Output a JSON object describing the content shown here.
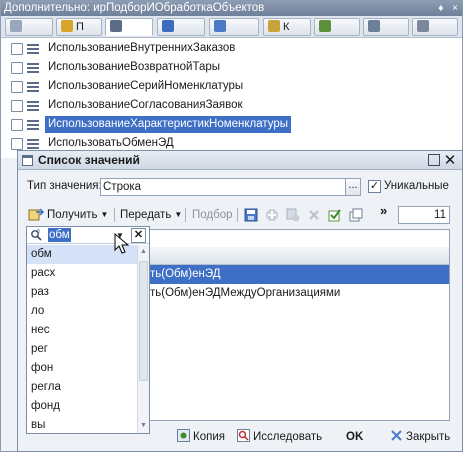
{
  "outer": {
    "title": "Дополнительно: ирПодборИОбработкаОбъектов",
    "title_controls": [
      "♦",
      "×"
    ],
    "tabs": [
      {
        "label": "",
        "color": "#9aa8bd"
      },
      {
        "label": "П",
        "color": "#d8a52b"
      },
      {
        "label": "",
        "color": "#5b6c88"
      },
      {
        "label": "",
        "color": "#3a6cc2"
      },
      {
        "label": "",
        "color": "#4b79c9"
      },
      {
        "label": "К",
        "color": "#c9a43a"
      },
      {
        "label": "",
        "color": "#5d8f3b"
      },
      {
        "label": "",
        "color": "#6b7f99"
      },
      {
        "label": "",
        "color": "#7b8899"
      }
    ]
  },
  "props": [
    {
      "label": "ИспользованиеВнутреннихЗаказов",
      "selected": false
    },
    {
      "label": "ИспользованиеВозвратнойТары",
      "selected": false
    },
    {
      "label": "ИспользованиеСерийНоменклатуры",
      "selected": false
    },
    {
      "label": "ИспользованиеСогласованияЗаявок",
      "selected": false
    },
    {
      "label": "ИспользованиеХарактеристикНоменклатуры",
      "selected": true
    },
    {
      "label": "ИспользоватьОбменЭД",
      "selected": false
    }
  ],
  "dialog": {
    "title": "Список значений",
    "type_label": "Тип значения:",
    "type_value": "Строка",
    "type_btn": "...",
    "unique_label": "Уникальные",
    "unique_checked": "✓",
    "toolbar": {
      "get_label": "Получить",
      "pass_label": "Передать",
      "select_label": "Подбор",
      "arrow": "▼",
      "more": "»",
      "count": "11"
    },
    "rows": [
      {
        "text": "ть(Обм)енЭД",
        "selected": true
      },
      {
        "text": "ть(Обм)енЭДМеждуОрганизациями",
        "selected": false
      }
    ],
    "buttons": {
      "copy": "Копия",
      "explore": "Исследовать",
      "ok": "OK",
      "close": "Закрыть"
    }
  },
  "filter": {
    "value": "обм",
    "dropdown_arrow": "▼",
    "clear": "✕",
    "scroll_up": "▲",
    "scroll_down": "▼",
    "items": [
      "обм",
      "расх",
      "раз",
      "ло",
      "нес",
      "рег",
      "фон",
      "регла",
      "фонд",
      "вы"
    ],
    "selected_index": 0
  },
  "colors": {
    "selection": "#3d6fc7",
    "title_bar": "#7d8ea7"
  }
}
